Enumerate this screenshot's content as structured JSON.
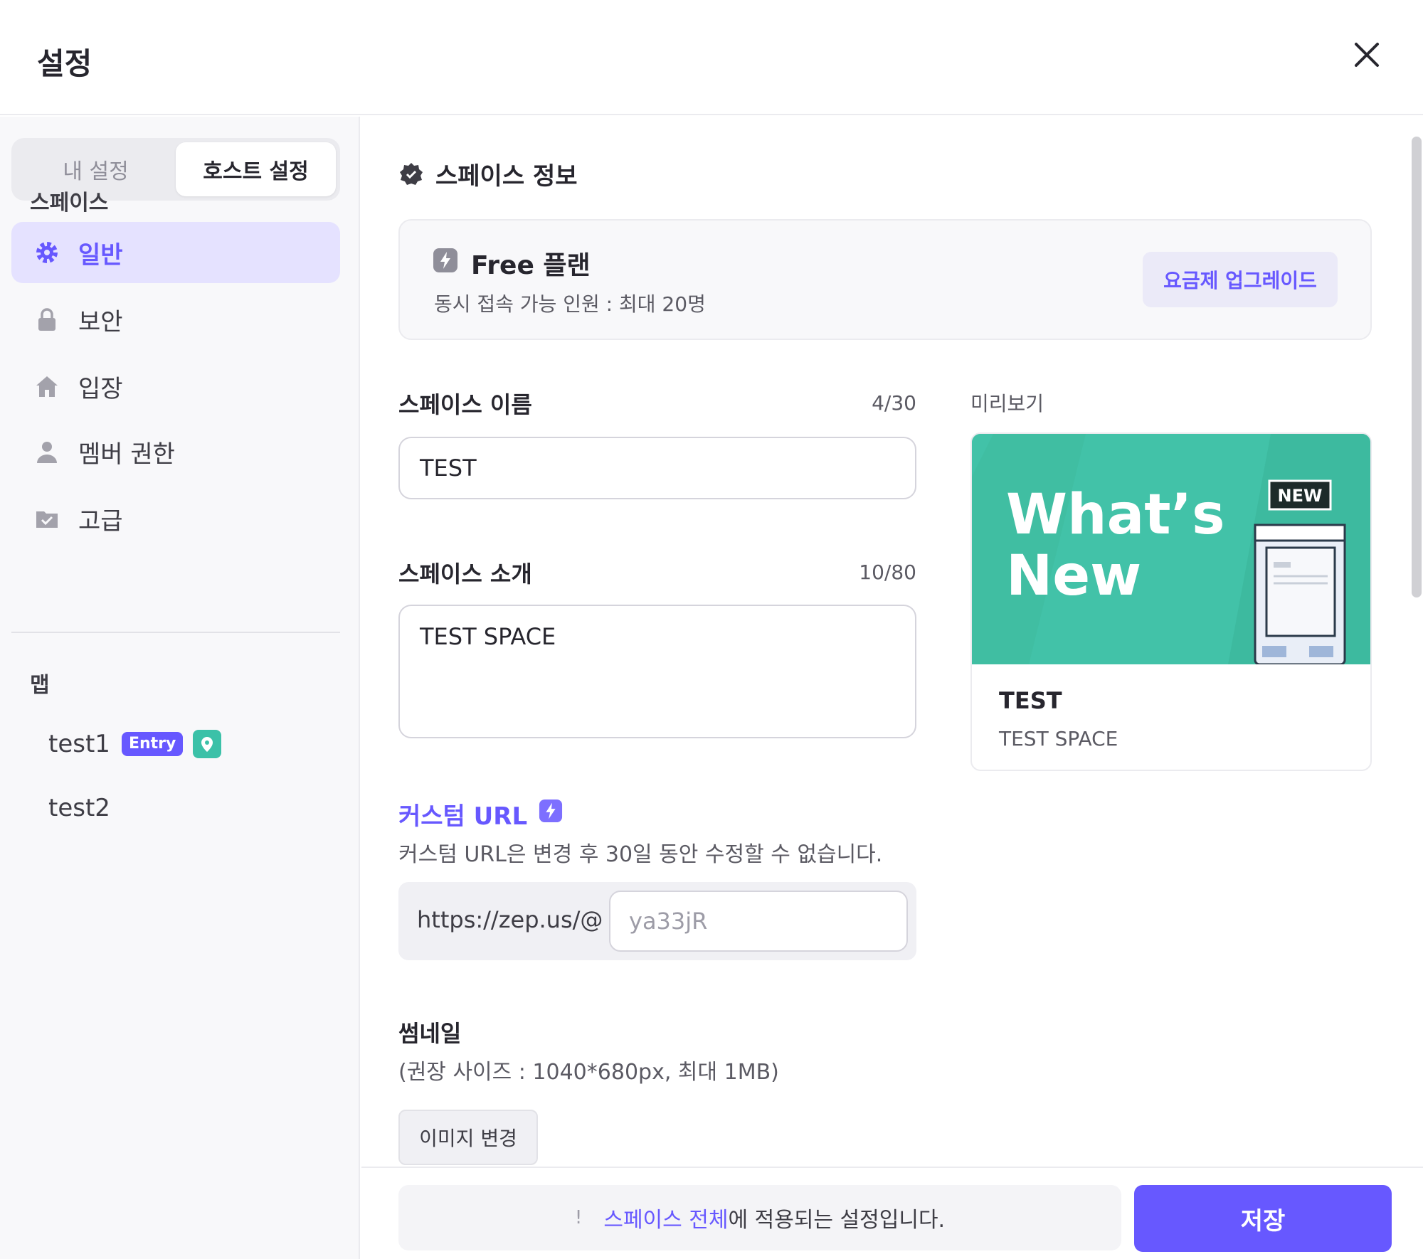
{
  "header": {
    "title": "설정",
    "close_icon": "close-icon"
  },
  "sidebar": {
    "tabs": [
      {
        "label": "내 설정",
        "active": false
      },
      {
        "label": "호스트 설정",
        "active": true
      }
    ],
    "space_section": "스페이스",
    "items": [
      {
        "label": "일반",
        "icon": "gear-icon",
        "active": true
      },
      {
        "label": "보안",
        "icon": "lock-icon",
        "active": false
      },
      {
        "label": "입장",
        "icon": "home-icon",
        "active": false
      },
      {
        "label": "멤버 권한",
        "icon": "person-icon",
        "active": false
      },
      {
        "label": "고급",
        "icon": "folder-icon",
        "active": false
      }
    ],
    "map_section": "맵",
    "maps": [
      {
        "name": "test1",
        "badge": "Entry",
        "has_pin": true
      },
      {
        "name": "test2"
      }
    ]
  },
  "main": {
    "section_title": "스페이스 정보",
    "plan": {
      "name": "Free 플랜",
      "desc": "동시 접속 가능 인원 : 최대 20명",
      "upgrade_label": "요금제 업그레이드"
    },
    "space_name": {
      "label": "스페이스 이름",
      "count": "4/30",
      "value": "TEST"
    },
    "space_intro": {
      "label": "스페이스 소개",
      "count": "10/80",
      "value": "TEST SPACE"
    },
    "preview": {
      "label": "미리보기",
      "banner_line1": "What’s",
      "banner_line2": "New",
      "banner_badge": "NEW",
      "title": "TEST",
      "desc": "TEST SPACE"
    },
    "custom_url": {
      "title": "커스텀 URL",
      "desc": "커스텀 URL은 변경 후 30일 동안 수정할 수 없습니다.",
      "prefix": "https://zep.us/@",
      "placeholder": "ya33jR"
    },
    "thumbnail": {
      "label": "썸네일",
      "desc": "(권장 사이즈 : 1040*680px, 최대 1MB)",
      "button": "이미지 변경"
    }
  },
  "footer": {
    "notice_mark": "!",
    "notice_highlight": "스페이스 전체",
    "notice_rest": "에 적용되는 설정입니다.",
    "save_label": "저장"
  },
  "colors": {
    "accent": "#6758ff",
    "accent_light": "#e5e2ff",
    "teal": "#42c2a8",
    "text": "#27262e"
  }
}
